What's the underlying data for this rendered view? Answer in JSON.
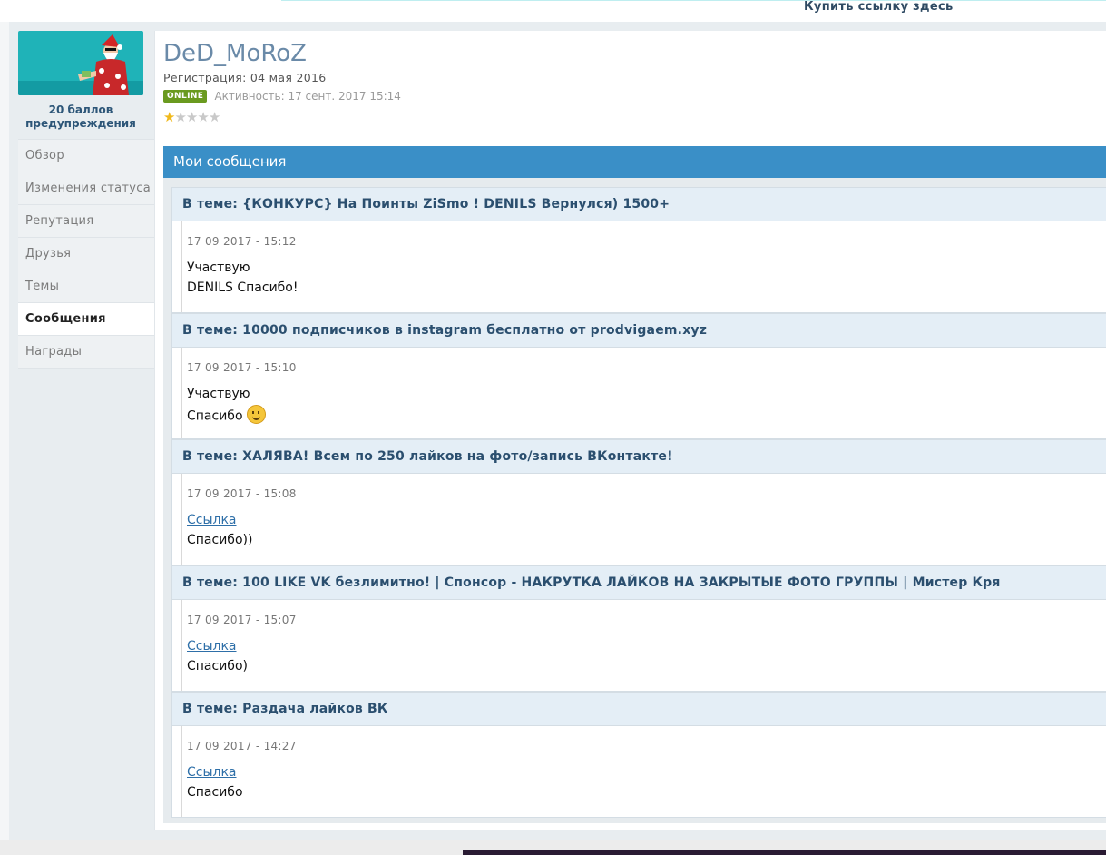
{
  "topbar": {
    "buy_link": "Купить ссылку здесь"
  },
  "profile": {
    "username": "DeD_MoRoZ",
    "registration": "Регистрация: 04 мая 2016",
    "status_badge": "ONLINE",
    "activity": "Активность: 17 сент. 2017 15:14",
    "rating": {
      "value": 1,
      "max": 5
    },
    "warnings": "20 баллов предупреждения"
  },
  "sidebar": {
    "items": [
      {
        "label": "Обзор"
      },
      {
        "label": "Изменения статуса"
      },
      {
        "label": "Репутация"
      },
      {
        "label": "Друзья"
      },
      {
        "label": "Темы"
      },
      {
        "label": "Сообщения",
        "active": true
      },
      {
        "label": "Награды"
      }
    ]
  },
  "section": {
    "title": "Мои сообщения"
  },
  "posts": [
    {
      "topic": "В теме: {КОНКУРС} На Поинты ZiSmo ! DENILS Вернулся) 1500+",
      "date": "17 09 2017 - 15:12",
      "line1": "Участвую",
      "line2": "DENILS Спасибо!"
    },
    {
      "topic": "В теме: 10000 подписчиков в instagram бесплатно от prodvigaem.xyz",
      "date": "17 09 2017 - 15:10",
      "line1": "Участвую",
      "line2": "Спасибо",
      "smiley": true
    },
    {
      "topic": "В теме: ХАЛЯВА! Всем по 250 лайков на фото/запись ВКонтакте!",
      "date": "17 09 2017 - 15:08",
      "link": "Ссылка",
      "line2": "Спасибо))"
    },
    {
      "topic": "В теме: 100 LIKE VK безлимитно! | Спонсор - НАКРУТКА ЛАЙКОВ НА ЗАКРЫТЫЕ ФОТО ГРУППЫ | Мистер Кря",
      "date": "17 09 2017 - 15:07",
      "link": "Ссылка",
      "line2": "Спасибо)"
    },
    {
      "topic": "В теме: Раздача лайков ВК",
      "date": "17 09 2017 - 14:27",
      "link": "Ссылка",
      "line2": "Спасибо"
    }
  ],
  "colors": {
    "accent": "#3a8fc7",
    "online": "#6a9a1f",
    "topic_bg": "#e4eef6"
  }
}
